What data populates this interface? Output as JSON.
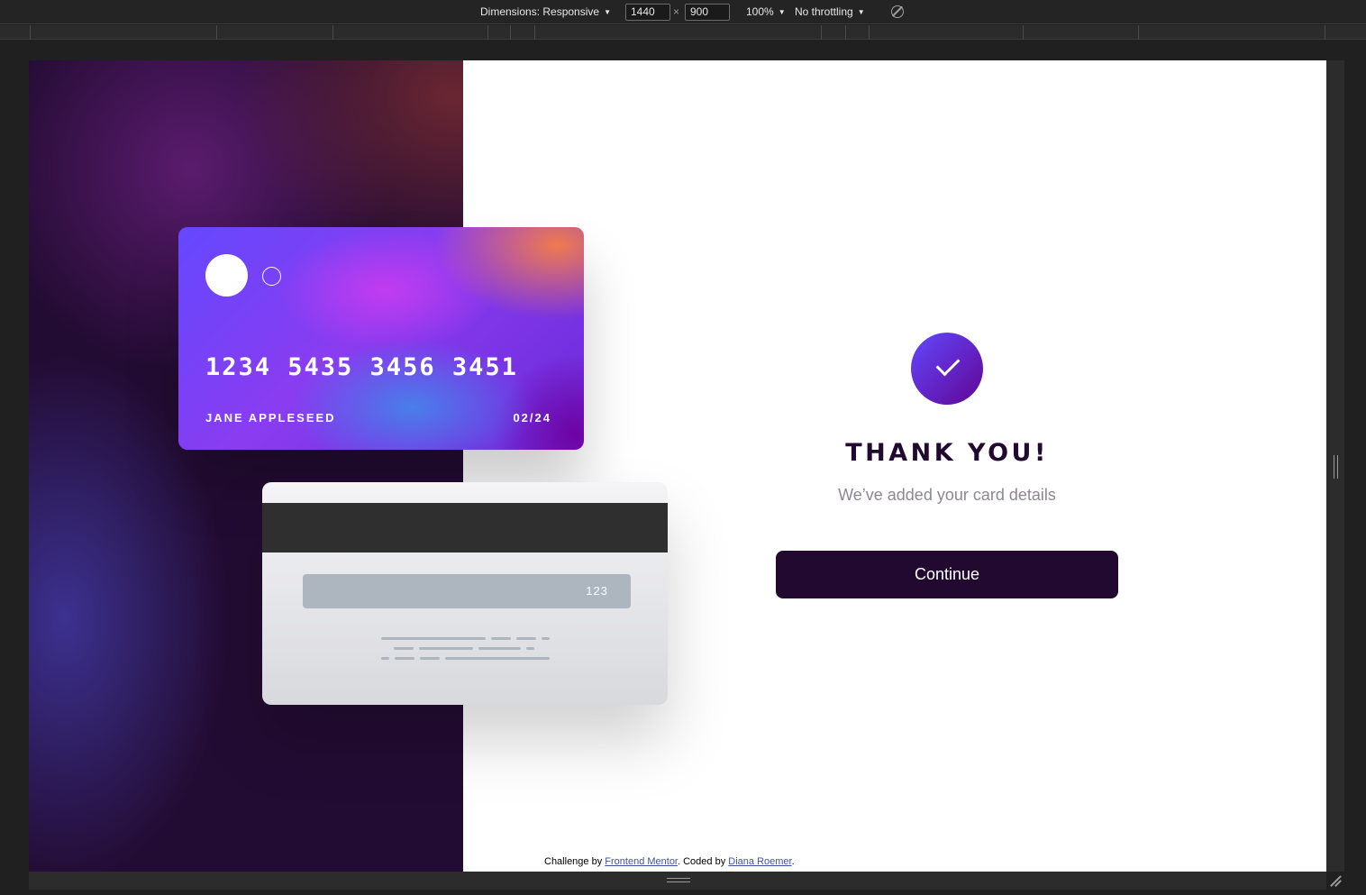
{
  "devtools": {
    "dimensions_label": "Dimensions: Responsive",
    "width_value": "1440",
    "height_value": "900",
    "times": "×",
    "zoom": "100%",
    "throttling": "No throttling",
    "caret": "▼"
  },
  "card_front": {
    "number": "1234 5435 3456 3451",
    "name": "JANE APPLESEED",
    "expiry": "02/24"
  },
  "card_back": {
    "cvc": "123"
  },
  "complete": {
    "title": "THANK YOU!",
    "subtitle": "We’ve added your card details",
    "button": "Continue"
  },
  "attribution": {
    "prefix": "Challenge by ",
    "link1": "Frontend Mentor",
    "middle": ". Coded by ",
    "link2": "Diana Roemer",
    "suffix": "."
  },
  "colors": {
    "dark_violet": "#21092f",
    "grayish_violet": "#8f8694",
    "gradient_start": "#6348fe",
    "gradient_end": "#610595"
  }
}
